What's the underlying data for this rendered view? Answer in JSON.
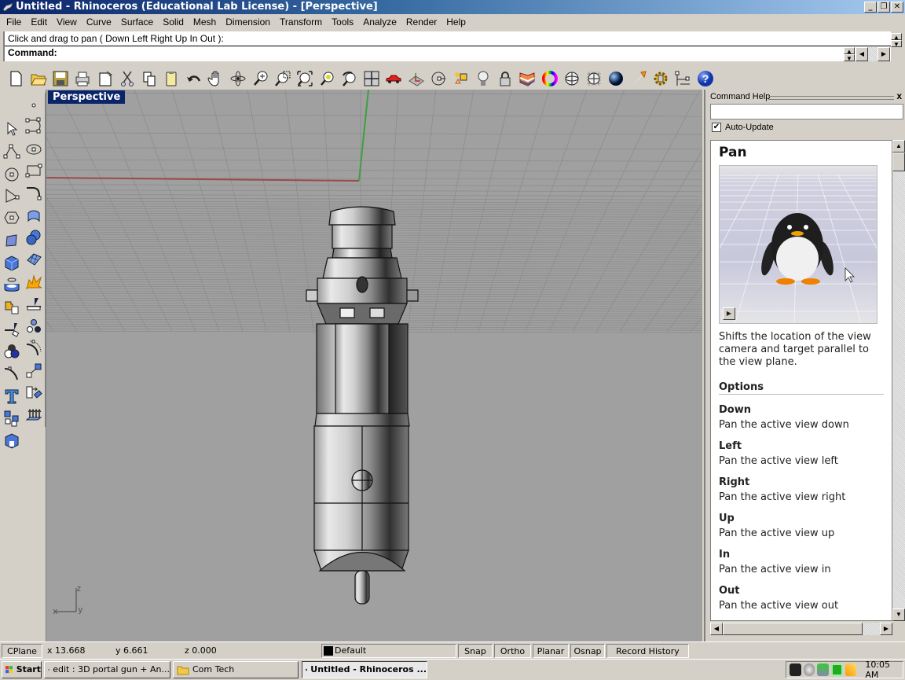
{
  "window": {
    "title": "Untitled - Rhinoceros (Educational Lab License) - [Perspective]",
    "controls": {
      "minimize": "_",
      "restore": "❐",
      "close": "✕"
    }
  },
  "menu": [
    "File",
    "Edit",
    "View",
    "Curve",
    "Surface",
    "Solid",
    "Mesh",
    "Dimension",
    "Transform",
    "Tools",
    "Analyze",
    "Render",
    "Help"
  ],
  "command": {
    "history_line": "Click and drag to pan ( Down  Left  Right  Up  In  Out ):",
    "prompt_label": "Command:",
    "input_value": ""
  },
  "toolbar": [
    {
      "name": "new-icon"
    },
    {
      "name": "open-icon"
    },
    {
      "name": "save-icon"
    },
    {
      "name": "print-icon"
    },
    {
      "name": "import-icon"
    },
    {
      "name": "cut-icon"
    },
    {
      "name": "copy-icon"
    },
    {
      "name": "paste-icon"
    },
    {
      "name": "undo-icon"
    },
    {
      "name": "pan-hand-icon"
    },
    {
      "name": "rotate-view-icon"
    },
    {
      "name": "zoom-dynamic-icon"
    },
    {
      "name": "zoom-window-icon"
    },
    {
      "name": "zoom-extents-icon"
    },
    {
      "name": "zoom-selected-icon"
    },
    {
      "name": "undo-view-icon"
    },
    {
      "name": "viewport-layout-icon"
    },
    {
      "name": "car-icon"
    },
    {
      "name": "grid-snap-icon"
    },
    {
      "name": "cplane-icon"
    },
    {
      "name": "object-properties-icon"
    },
    {
      "name": "light-bulb-icon"
    },
    {
      "name": "lock-icon"
    },
    {
      "name": "layers-icon"
    },
    {
      "name": "color-wheel-icon"
    },
    {
      "name": "wireframe-sphere-icon"
    },
    {
      "name": "ghosted-sphere-icon"
    },
    {
      "name": "rendered-sphere-icon"
    },
    {
      "name": "spotlight-icon"
    },
    {
      "name": "options-gear-icon"
    },
    {
      "name": "dimension-icon"
    },
    {
      "name": "help-icon"
    }
  ],
  "left_toolbar_1": [
    "select-arrow-icon",
    "polyline-icon",
    "circle-icon",
    "arc-icon",
    "polygon-icon",
    "surface-from-points-icon",
    "box-icon",
    "cylinder-icon",
    "boolean-puzzle-icon",
    "trim-icon",
    "solid-boolean-icon",
    "fillet-curve-icon",
    "text-icon",
    "group-icon",
    "block-icon"
  ],
  "left_toolbar_2": [
    "point-icon",
    "curve-icon",
    "ellipse-icon",
    "rectangle-icon",
    "fillet-icon",
    "extrude-surface-icon",
    "sphere-icon",
    "mesh-icon",
    "explode-icon",
    "split-icon",
    "array-icon",
    "offset-icon",
    "scale-icon",
    "move-icon",
    "extrude-arrows-icon"
  ],
  "viewport": {
    "label": "Perspective",
    "axis_labels": {
      "x": "x",
      "y": "y",
      "z": "z"
    },
    "colors": {
      "background": "#a0a0a0",
      "grid": "#8c8c8c",
      "x_axis": "#9b4a4a",
      "y_axis": "#3f9f3f"
    }
  },
  "command_help": {
    "header": "Command Help",
    "close": "x",
    "search_value": "",
    "auto_update_label": "Auto-Update",
    "auto_update_checked": true,
    "title": "Pan",
    "description": "Shifts the location of the view camera and target parallel to the view plane.",
    "options_heading": "Options",
    "options": [
      {
        "name": "Down",
        "desc": "Pan the active view down"
      },
      {
        "name": "Left",
        "desc": "Pan the active view left"
      },
      {
        "name": "Right",
        "desc": "Pan the active view right"
      },
      {
        "name": "Up",
        "desc": "Pan the active view up"
      },
      {
        "name": "In",
        "desc": "Pan the active view in"
      },
      {
        "name": "Out",
        "desc": "Pan the active view out"
      }
    ]
  },
  "status": {
    "cplane": "CPlane",
    "x": "x 13.668",
    "y": "y 6.661",
    "z": "z 0.000",
    "layer": "Default",
    "layer_color": "#000000",
    "toggles": [
      "Snap",
      "Ortho",
      "Planar",
      "Osnap",
      "Record History"
    ]
  },
  "taskbar": {
    "start": "Start",
    "tasks": [
      {
        "label": "edit : 3D portal gun + An...",
        "icon": "firefox-icon",
        "active": false
      },
      {
        "label": "Com Tech",
        "icon": "folder-icon",
        "active": false
      },
      {
        "label": "Untitled - Rhinoceros ...",
        "icon": "rhino-icon",
        "active": true
      }
    ],
    "clock": "10:05 AM"
  }
}
